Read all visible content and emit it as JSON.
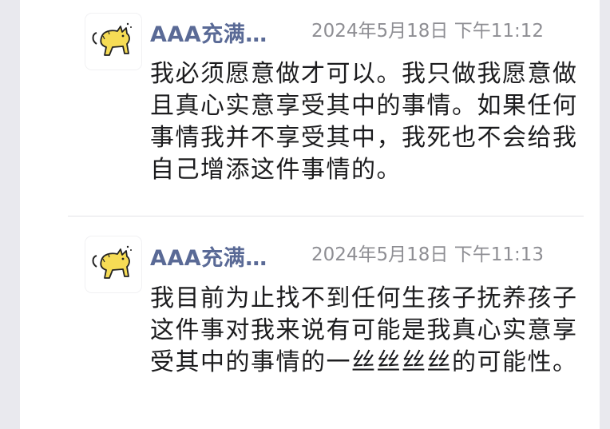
{
  "messages": [
    {
      "sender": "AAA充满…",
      "timestamp": "2024年5月18日 下午11:12",
      "text": "我必须愿意做才可以。我只做我愿意做且真心实意享受其中的事情。如果任何事情我并不享受其中，我死也不会给我自己增添这件事情的。",
      "avatar_icon": "yellow-cat-icon"
    },
    {
      "sender": "AAA充满…",
      "timestamp": "2024年5月18日 下午11:13",
      "text": "我目前为止找不到任何生孩子抚养孩子这件事对我来说有可能是我真心实意享受其中的事情的一丝丝丝丝的可能性。",
      "avatar_icon": "yellow-cat-icon"
    }
  ],
  "colors": {
    "sender": "#5a6a96",
    "timestamp": "#8e8e93",
    "text": "#1c1c1e",
    "cat_fill": "#f6dc55"
  }
}
